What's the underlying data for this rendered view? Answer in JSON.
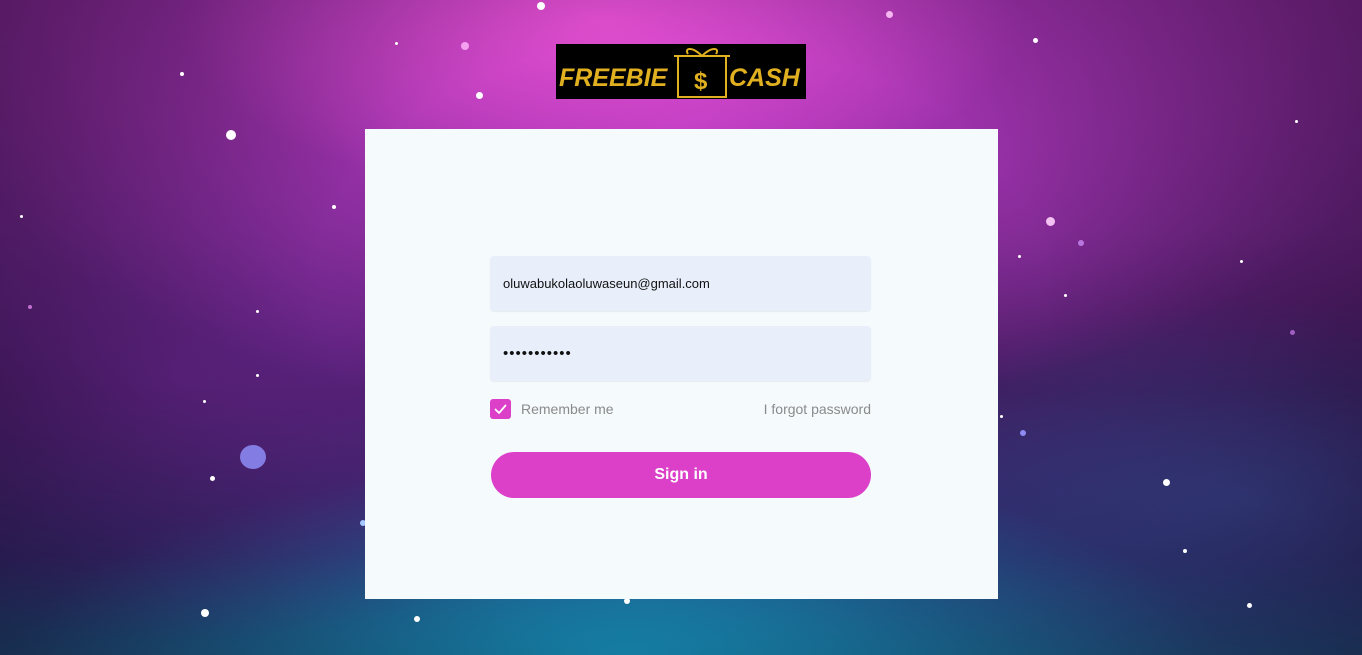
{
  "logo": {
    "text_left": "FREEBIE",
    "text_symbol": "$",
    "text_right": "CASH",
    "color": "#e0b020"
  },
  "login": {
    "email_value": "oluwabukolaoluwaseun@gmail.com",
    "password_value": "•••••••••••",
    "remember_label": "Remember me",
    "remember_checked": true,
    "forgot_label": "I forgot password",
    "signin_label": "Sign in"
  },
  "colors": {
    "accent": "#dc3fc8",
    "card_bg": "#f5fafd",
    "input_bg": "#e8effb"
  }
}
